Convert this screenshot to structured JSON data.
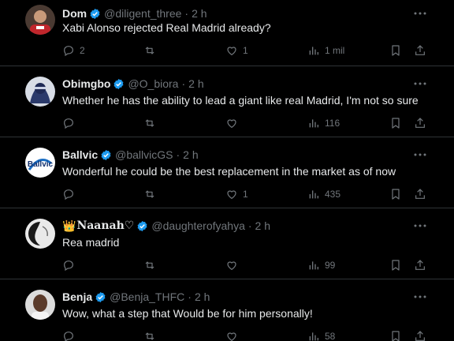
{
  "tweets": [
    {
      "name": "Dom",
      "handle": "@diligent_three",
      "time": "2 h",
      "text": "Xabi Alonso rejected Real Madrid already?",
      "replies": "2",
      "retweets": "",
      "likes": "1",
      "views": "1 mil"
    },
    {
      "name": "Obimgbo",
      "handle": "@O_biora",
      "time": "2 h",
      "text": "Whether he has the ability to lead a giant like real Madrid, I'm not so sure",
      "replies": "",
      "retweets": "",
      "likes": "",
      "views": "116"
    },
    {
      "name": "Ballvic",
      "handle": "@ballvicGS",
      "time": "2 h",
      "text": "Wonderful he could be the best replacement in the market as of now",
      "replies": "",
      "retweets": "",
      "likes": "1",
      "views": "435",
      "avatar_text": "Ballvic"
    },
    {
      "name": "Naanah♡",
      "name_prefix": "👑",
      "handle": "@daughterofyahya",
      "time": "2 h",
      "text": "Rea madrid",
      "replies": "",
      "retweets": "",
      "likes": "",
      "views": "99"
    },
    {
      "name": "Benja",
      "handle": "@Benja_THFC",
      "time": "2 h",
      "text": "Wow, what a step that Would be for him personally!",
      "replies": "",
      "retweets": "",
      "likes": "",
      "views": "58"
    }
  ],
  "colors": {
    "background": "#000000",
    "verified": "#1d9bf0",
    "muted": "#71767b",
    "text": "#e7e9ea",
    "divider": "#2f3336"
  },
  "icons": [
    "verified-badge-icon",
    "more-icon",
    "reply-icon",
    "retweet-icon",
    "like-icon",
    "views-icon",
    "bookmark-icon",
    "share-icon"
  ]
}
